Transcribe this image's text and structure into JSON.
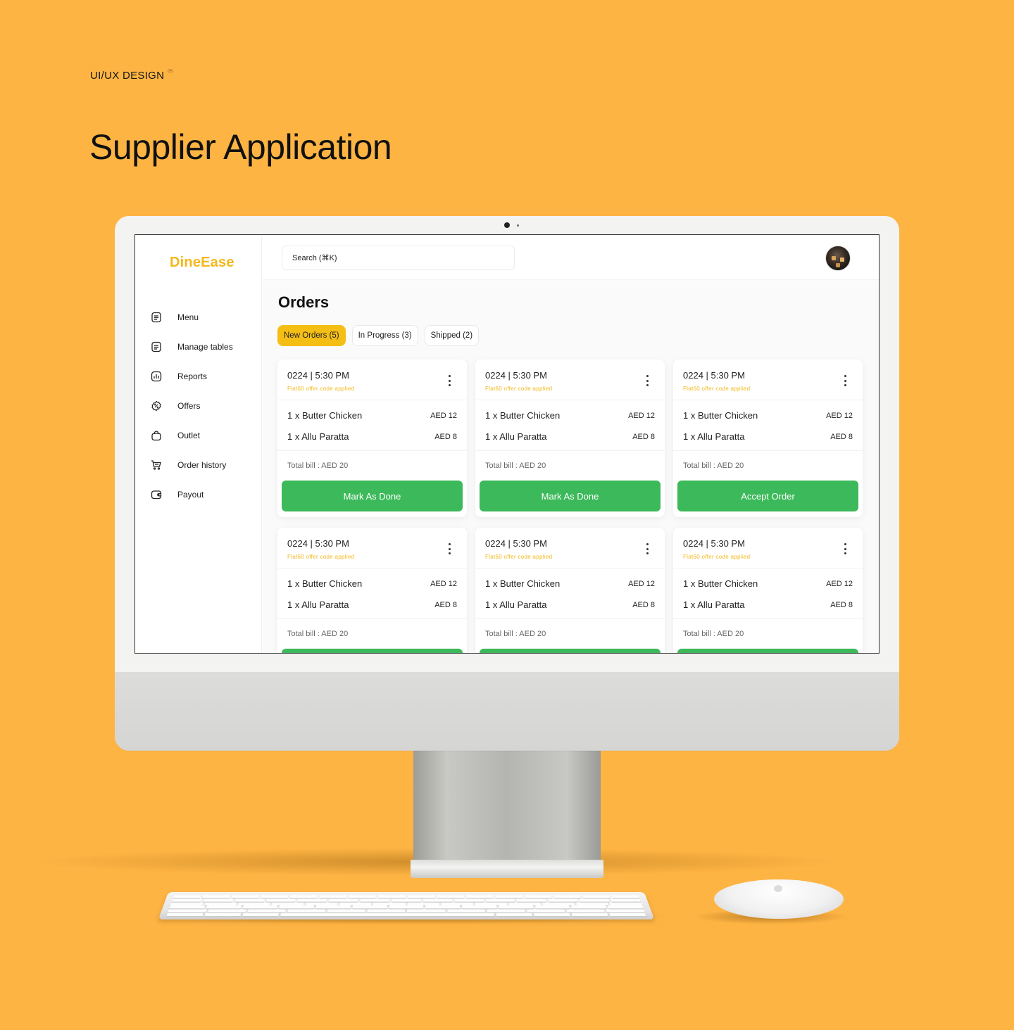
{
  "header": {
    "kicker": "UI/UX DESIGN",
    "kicker_sup": "05",
    "title": "Supplier Application"
  },
  "app": {
    "brand": "DineEase",
    "brand_color": "#F4B81C",
    "search": {
      "placeholder": "Search (⌘K)"
    },
    "sidebar": {
      "items": [
        {
          "label": "Menu",
          "icon": "menu-doc-icon"
        },
        {
          "label": "Manage tables",
          "icon": "tables-doc-icon"
        },
        {
          "label": "Reports",
          "icon": "bar-chart-icon"
        },
        {
          "label": "Offers",
          "icon": "discount-badge-icon"
        },
        {
          "label": "Outlet",
          "icon": "shopping-bag-icon"
        },
        {
          "label": "Order history",
          "icon": "cart-icon"
        },
        {
          "label": "Payout",
          "icon": "wallet-icon"
        }
      ]
    },
    "page_title": "Orders",
    "tabs": [
      {
        "label": "New Orders (5)",
        "active": true
      },
      {
        "label": "In Progress (3)",
        "active": false
      },
      {
        "label": "Shipped (2)",
        "active": false
      }
    ],
    "orders": [
      {
        "id": "0224 | 5:30 PM",
        "offer": "Flat60 offer code applied",
        "items": [
          {
            "name": "1 x Butter Chicken",
            "price": "AED 12"
          },
          {
            "name": "1 x Allu Paratta",
            "price": "AED 8"
          }
        ],
        "total": "Total bill : AED 20",
        "action": "Mark As Done"
      },
      {
        "id": "0224 | 5:30 PM",
        "offer": "Flat60 offer code applied",
        "items": [
          {
            "name": "1 x Butter Chicken",
            "price": "AED 12"
          },
          {
            "name": "1 x Allu Paratta",
            "price": "AED 8"
          }
        ],
        "total": "Total bill : AED 20",
        "action": "Mark As Done"
      },
      {
        "id": "0224 | 5:30 PM",
        "offer": "Flat60 offer code applied",
        "items": [
          {
            "name": "1 x Butter Chicken",
            "price": "AED 12"
          },
          {
            "name": "1 x Allu Paratta",
            "price": "AED 8"
          }
        ],
        "total": "Total bill : AED 20",
        "action": "Accept Order"
      },
      {
        "id": "0224 | 5:30 PM",
        "offer": "Flat60 offer code applied",
        "items": [
          {
            "name": "1 x Butter Chicken",
            "price": "AED 12"
          },
          {
            "name": "1 x Allu Paratta",
            "price": "AED 8"
          }
        ],
        "total": "Total bill : AED 20",
        "action": ""
      },
      {
        "id": "0224 | 5:30 PM",
        "offer": "Flat60 offer code applied",
        "items": [
          {
            "name": "1 x Butter Chicken",
            "price": "AED 12"
          },
          {
            "name": "1 x Allu Paratta",
            "price": "AED 8"
          }
        ],
        "total": "Total bill : AED 20",
        "action": ""
      },
      {
        "id": "0224 | 5:30 PM",
        "offer": "Flat60 offer code applied",
        "items": [
          {
            "name": "1 x Butter Chicken",
            "price": "AED 12"
          },
          {
            "name": "1 x Allu Paratta",
            "price": "AED 8"
          }
        ],
        "total": "Total bill : AED 20",
        "action": ""
      }
    ],
    "colors": {
      "background": "#FEB443",
      "tab_active": "#F4BE15",
      "button": "#3CB95A",
      "offer_text": "#F4B81C"
    }
  }
}
